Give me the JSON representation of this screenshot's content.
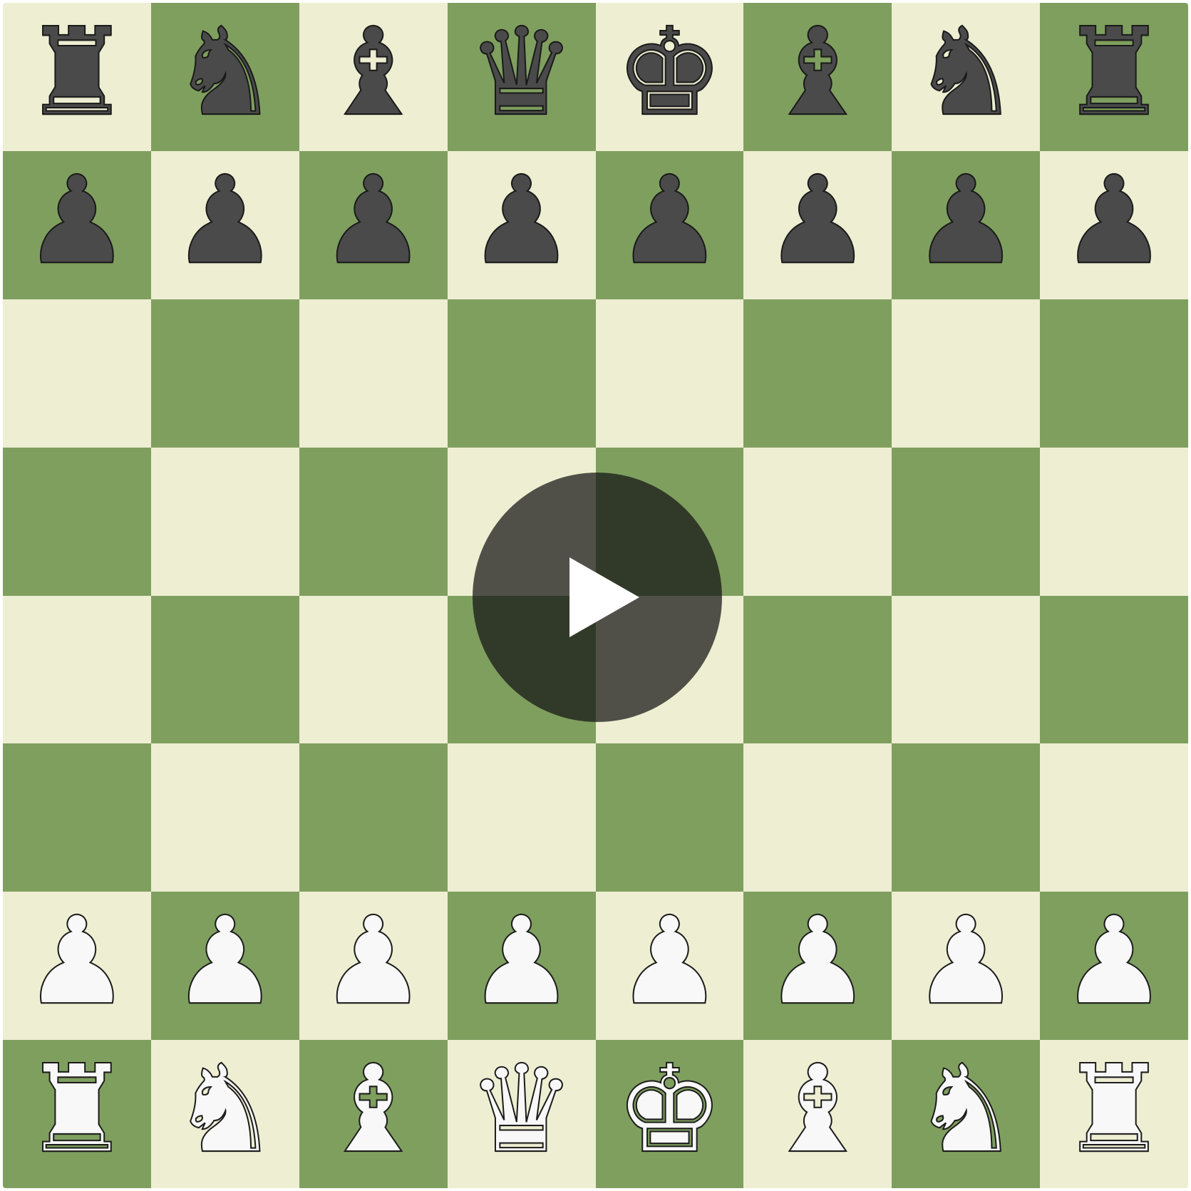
{
  "board": {
    "light_color": "#eeeed2",
    "dark_color": "#7f9f5f",
    "ranks": [
      [
        "r",
        "n",
        "b",
        "q",
        "k",
        "b",
        "n",
        "r"
      ],
      [
        "p",
        "p",
        "p",
        "p",
        "p",
        "p",
        "p",
        "p"
      ],
      [
        "",
        "",
        "",
        "",
        "",
        "",
        "",
        ""
      ],
      [
        "",
        "",
        "",
        "",
        "",
        "",
        "",
        ""
      ],
      [
        "",
        "",
        "",
        "",
        "",
        "",
        "",
        ""
      ],
      [
        "",
        "",
        "",
        "",
        "",
        "",
        "",
        ""
      ],
      [
        "P",
        "P",
        "P",
        "P",
        "P",
        "P",
        "P",
        "P"
      ],
      [
        "R",
        "N",
        "B",
        "Q",
        "K",
        "B",
        "N",
        "R"
      ]
    ]
  },
  "pieces": {
    "K": {
      "glyph": "♚",
      "name": "white-king-icon",
      "color": "white"
    },
    "Q": {
      "glyph": "♛",
      "name": "white-queen-icon",
      "color": "white"
    },
    "R": {
      "glyph": "♜",
      "name": "white-rook-icon",
      "color": "white"
    },
    "B": {
      "glyph": "♝",
      "name": "white-bishop-icon",
      "color": "white"
    },
    "N": {
      "glyph": "♞",
      "name": "white-knight-icon",
      "color": "white"
    },
    "P": {
      "glyph": "♟",
      "name": "white-pawn-icon",
      "color": "white"
    },
    "k": {
      "glyph": "♚",
      "name": "black-king-icon",
      "color": "black"
    },
    "q": {
      "glyph": "♛",
      "name": "black-queen-icon",
      "color": "black"
    },
    "r": {
      "glyph": "♜",
      "name": "black-rook-icon",
      "color": "black"
    },
    "b": {
      "glyph": "♝",
      "name": "black-bishop-icon",
      "color": "black"
    },
    "n": {
      "glyph": "♞",
      "name": "black-knight-icon",
      "color": "black"
    },
    "p": {
      "glyph": "♟",
      "name": "black-pawn-icon",
      "color": "black"
    }
  },
  "overlay": {
    "icon": "play-icon"
  }
}
